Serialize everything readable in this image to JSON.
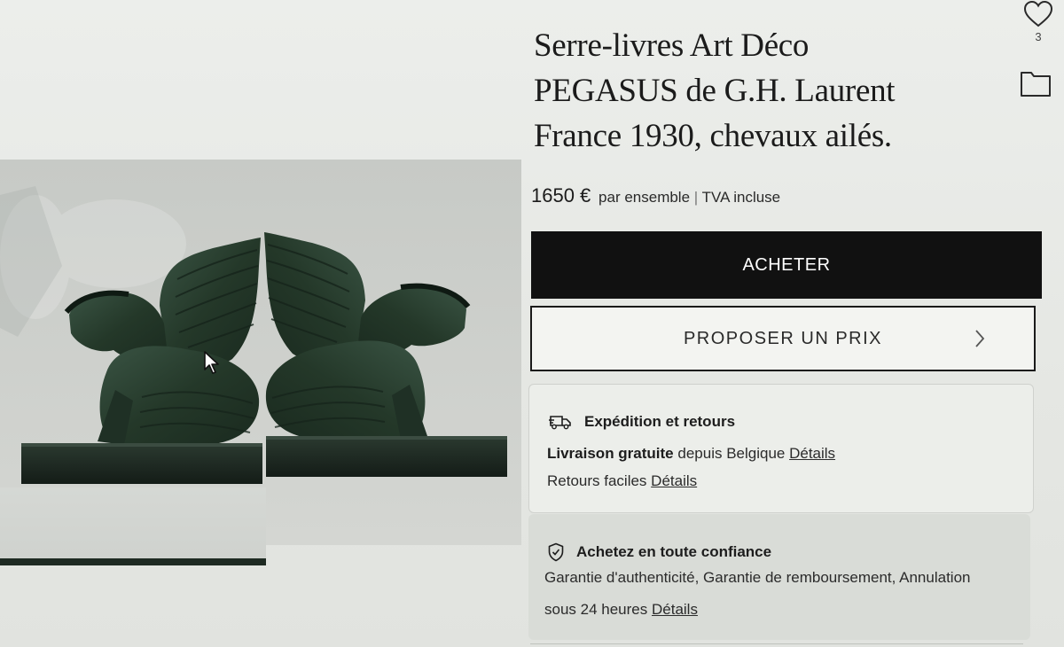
{
  "product": {
    "title_lines": [
      "Serre-livres Art Déco",
      "PEGASUS de G.H. Laurent",
      "France 1930, chevaux ailés."
    ],
    "image_alt": "Serre-livres Pegasus en bronze à patine verte"
  },
  "favorites": {
    "count": "3",
    "icon": "heart-icon"
  },
  "collection": {
    "icon": "folder-icon"
  },
  "price": {
    "amount": "1650 €",
    "unit": "par ensemble",
    "separator": "|",
    "tax": "TVA incluse"
  },
  "actions": {
    "buy_label": "ACHETER",
    "offer_label": "PROPOSER UN PRIX",
    "offer_icon": "chevron-right-icon"
  },
  "shipping": {
    "icon": "truck-icon",
    "heading": "Expédition et retours",
    "free_delivery_bold": "Livraison gratuite",
    "free_delivery_rest": "depuis Belgique",
    "details_label_1": "Détails",
    "returns_text": "Retours faciles",
    "details_label_2": "Détails"
  },
  "trust": {
    "icon": "shield-check-icon",
    "heading": "Achetez en toute confiance",
    "line1": "Garantie d'authenticité, Garantie de remboursement, Annulation",
    "line2": "sous 24 heures",
    "details_label": "Détails"
  },
  "colors": {
    "button_dark": "#111111",
    "bronze_patina": "#2e4434",
    "page_bg": "#e6e8e4"
  }
}
